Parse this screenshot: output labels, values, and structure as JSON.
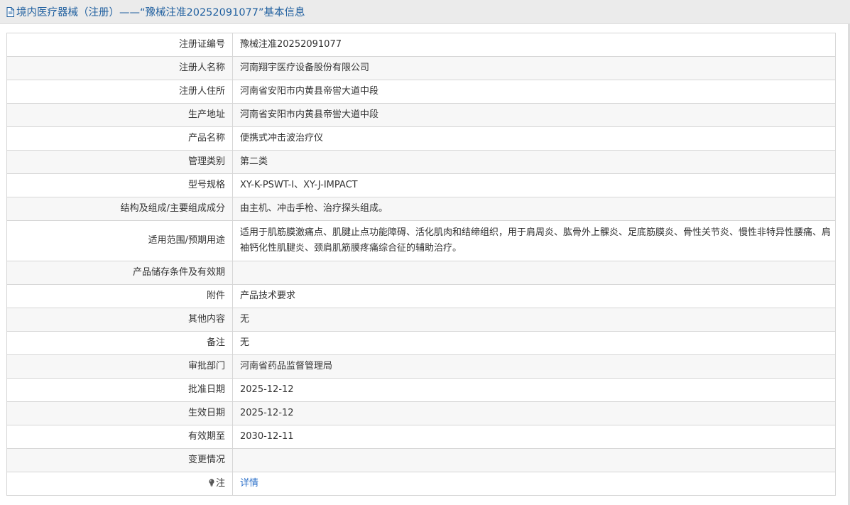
{
  "header": {
    "title": "境内医疗器械（注册）——“豫械注准20252091077”基本信息",
    "icon": "document-icon"
  },
  "colors": {
    "title": "#1f5f9f",
    "link": "#2a6fc9",
    "border": "#d6d6d6"
  },
  "rows": [
    {
      "label": "注册证编号",
      "value": "豫械注准20252091077"
    },
    {
      "label": "注册人名称",
      "value": "河南翔宇医疗设备股份有限公司"
    },
    {
      "label": "注册人住所",
      "value": "河南省安阳市内黄县帝喾大道中段"
    },
    {
      "label": "生产地址",
      "value": "河南省安阳市内黄县帝喾大道中段"
    },
    {
      "label": "产品名称",
      "value": "便携式冲击波治疗仪"
    },
    {
      "label": "管理类别",
      "value": "第二类"
    },
    {
      "label": "型号规格",
      "value": "XY-K-PSWT-I、XY-J-IMPACT"
    },
    {
      "label": "结构及组成/主要组成成分",
      "value": "由主机、冲击手枪、治疗探头组成。"
    },
    {
      "label": "适用范围/预期用途",
      "value": "适用于肌筋膜激痛点、肌腱止点功能障碍、活化肌肉和结缔组织，用于肩周炎、肱骨外上髁炎、足底筋膜炎、骨性关节炎、慢性非特异性腰痛、肩袖钙化性肌腱炎、颈肩肌筋膜疼痛综合征的辅助治疗。"
    },
    {
      "label": "产品储存条件及有效期",
      "value": ""
    },
    {
      "label": "附件",
      "value": "产品技术要求"
    },
    {
      "label": "其他内容",
      "value": "无"
    },
    {
      "label": "备注",
      "value": "无"
    },
    {
      "label": "审批部门",
      "value": "河南省药品监督管理局"
    },
    {
      "label": "批准日期",
      "value": "2025-12-12"
    },
    {
      "label": "生效日期",
      "value": "2025-12-12"
    },
    {
      "label": "有效期至",
      "value": "2030-12-11"
    },
    {
      "label": "变更情况",
      "value": ""
    },
    {
      "label": "注",
      "value": "详情",
      "icon": "lightbulb-icon"
    }
  ]
}
